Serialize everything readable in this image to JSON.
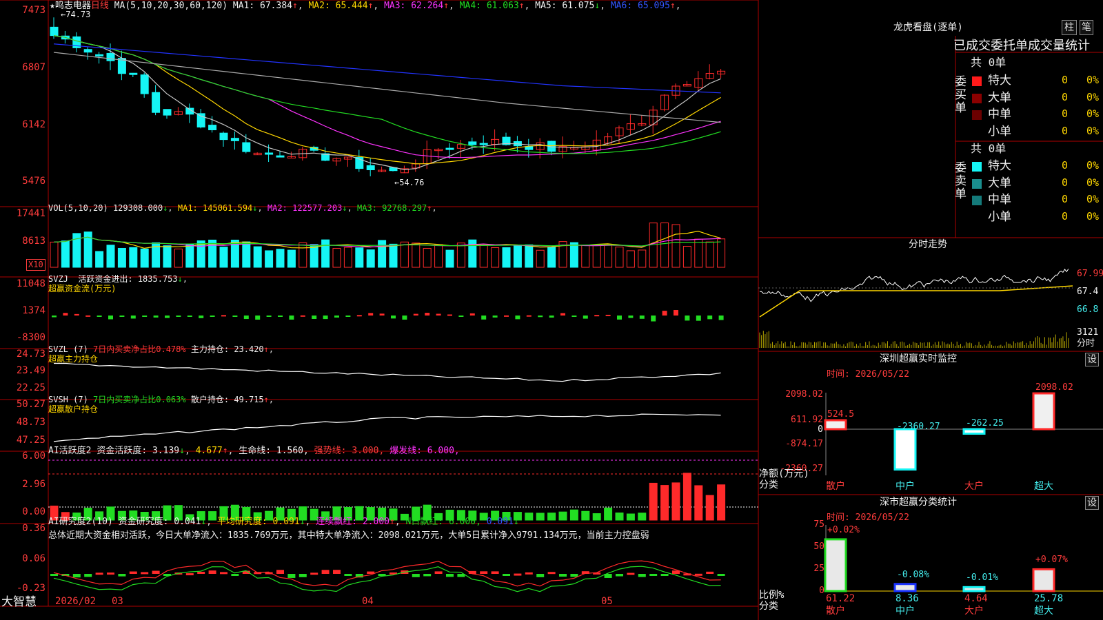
{
  "app": {
    "brand": "大智慧"
  },
  "stock": {
    "name": "鸣志电器",
    "period": "日线"
  },
  "colors": {
    "up": "#ff2a2a",
    "down": "#15f5f5",
    "bg": "#000000",
    "grid": "#b00000",
    "ma1": "#c8c8c8",
    "ma2": "#ffd700",
    "ma3": "#ff33ff",
    "ma4": "#22dd22",
    "ma5": "#aaaaaa",
    "ma6": "#2233ff"
  },
  "main": {
    "ma_title": "MA(5,10,20,30,60,120)",
    "ma_items": [
      {
        "label": "MA1:",
        "value": "67.384",
        "arrow": "↑",
        "cls": "white"
      },
      {
        "label": "MA2:",
        "value": "65.444",
        "arrow": "↑",
        "cls": "yellow"
      },
      {
        "label": "MA3:",
        "value": "62.264",
        "arrow": "↑",
        "cls": "magenta"
      },
      {
        "label": "MA4:",
        "value": "61.063",
        "arrow": "↑",
        "cls": "green"
      },
      {
        "label": "MA5:",
        "value": "61.075",
        "arrow": "↓",
        "cls": "white"
      },
      {
        "label": "MA6:",
        "value": "65.095",
        "arrow": "↑",
        "cls": "blue"
      }
    ],
    "y_labels": [
      "7473",
      "6807",
      "6142",
      "5476"
    ],
    "high_note": "74.73",
    "low_note": "54.76"
  },
  "vol": {
    "title": "VOL(5,10,20)",
    "value": "129308.000",
    "items": [
      {
        "label": "MA1:",
        "value": "145061.594",
        "arrow": "↓",
        "cls": "yellow"
      },
      {
        "label": "MA2:",
        "value": "122577.203",
        "arrow": "↓",
        "cls": "magenta"
      },
      {
        "label": "MA3:",
        "value": "92768.297",
        "arrow": "↑",
        "cls": "green"
      }
    ],
    "y_labels": [
      "17441",
      "8613"
    ],
    "unit": "X10"
  },
  "svzj": {
    "title": "SVZJ",
    "label": "活跃资金进出:",
    "value": "1835.753",
    "arrow": "↓",
    "sub": "超赢资金流(万元)",
    "y_labels": [
      "11048",
      "1374",
      "-8300"
    ]
  },
  "svzl": {
    "title": "SVZL (7)",
    "desc": "7日内买卖净占比0.478%",
    "label": "主力持仓:",
    "value": "23.420",
    "arrow": "↑",
    "sub": "超赢主力持仓",
    "y_labels": [
      "24.73",
      "23.49",
      "22.25"
    ]
  },
  "svsh": {
    "title": "SVSH (7)",
    "desc": "7日内买卖净占比0.063%",
    "label": "散户持仓:",
    "value": "49.715",
    "arrow": "↑",
    "sub": "超赢散户持仓",
    "y_labels": [
      "50.27",
      "48.73",
      "47.25"
    ]
  },
  "ai_active": {
    "title": "AI活跃度2",
    "label": "资金活跃度:",
    "v1": "3.139",
    "a1": "↓",
    "v2": "4.677",
    "a2": "↑",
    "life": "生命线: 1.560,",
    "strong": "强势线: 3.000,",
    "burst": "爆发线: 6.000,",
    "y_labels": [
      "6.00",
      "2.96",
      "0.00"
    ]
  },
  "ai_research": {
    "title": "AI研究度2(10)",
    "label": "资金研究度:",
    "v1": "0.041",
    "a1": "↓",
    "avg": "平均研究度: 0.091",
    "a2": "↓",
    "consec": "连续飘红: 2.000",
    "a3": "↑",
    "nday": "N日飘红: 6.000,",
    "extra": "0.091",
    "a4": "↓",
    "summary": "总体近期大资金相对活跃，今日大单净流入：1835.769万元，其中特大单净流入：2098.021万元，大单5日累计净入9791.134万元，当前主力控盘弱",
    "y_labels": [
      "0.36",
      "0.06",
      "-0.23"
    ]
  },
  "x_axis": {
    "labels": [
      "2026/02",
      "03",
      "04",
      "05"
    ]
  },
  "right": {
    "dragon_title": "龙虎看盘(逐单)",
    "btn_zhu": "柱",
    "btn_bi": "笔",
    "stats_title": "已成交委托单成交量统计",
    "buy": {
      "total": "共 0单",
      "side": "委买单",
      "rows": [
        {
          "name": "特大",
          "v": "0",
          "p": "0%"
        },
        {
          "name": "大单",
          "v": "0",
          "p": "0%"
        },
        {
          "name": "中单",
          "v": "0",
          "p": "0%"
        },
        {
          "name": "小单",
          "v": "0",
          "p": "0%"
        }
      ]
    },
    "sell": {
      "total": "共 0单",
      "side": "委卖单",
      "rows": [
        {
          "name": "特大",
          "v": "0",
          "p": "0%"
        },
        {
          "name": "大单",
          "v": "0",
          "p": "0%"
        },
        {
          "name": "中单",
          "v": "0",
          "p": "0%"
        },
        {
          "name": "小单",
          "v": "0",
          "p": "0%"
        }
      ]
    },
    "intraday_title": "分时走势",
    "intraday_labels": [
      "67.99",
      "67.4",
      "66.8",
      "3121"
    ],
    "intraday_unit": "分时",
    "monitor_title": "深圳超赢实时监控",
    "monitor_time": "时间: 2026/05/22",
    "set_label": "设",
    "monitor_axis": [
      "2098.02",
      "611.92",
      "0",
      "-874.17",
      "-2360.27"
    ],
    "monitor_ylabel": "净额(万元)",
    "monitor_xlabel": "分类",
    "classify_title": "深市超赢分类统计",
    "classify_time": "时间: 2026/05/22",
    "classify_axis": [
      "75",
      "50",
      "25",
      "0"
    ],
    "classify_ylabel": "比例%",
    "classify_xlabel": "分类"
  },
  "chart_data": [
    {
      "type": "bar",
      "title": "深圳超赢实时监控",
      "ylabel": "净额(万元)",
      "xlabel": "分类",
      "categories": [
        "散户",
        "中户",
        "大户",
        "超大"
      ],
      "values": [
        524.5,
        -2360.27,
        -262.25,
        2098.02
      ],
      "ylim": [
        -2360.27,
        2098.02
      ]
    },
    {
      "type": "bar",
      "title": "深市超赢分类统计",
      "ylabel": "比例%",
      "xlabel": "分类",
      "categories": [
        "散户",
        "中户",
        "大户",
        "超大"
      ],
      "values": [
        61.22,
        8.36,
        4.64,
        25.78
      ],
      "changes": [
        "+0.02%",
        "-0.08%",
        "-0.01%",
        "+0.07%"
      ],
      "ylim": [
        0,
        75
      ]
    }
  ]
}
